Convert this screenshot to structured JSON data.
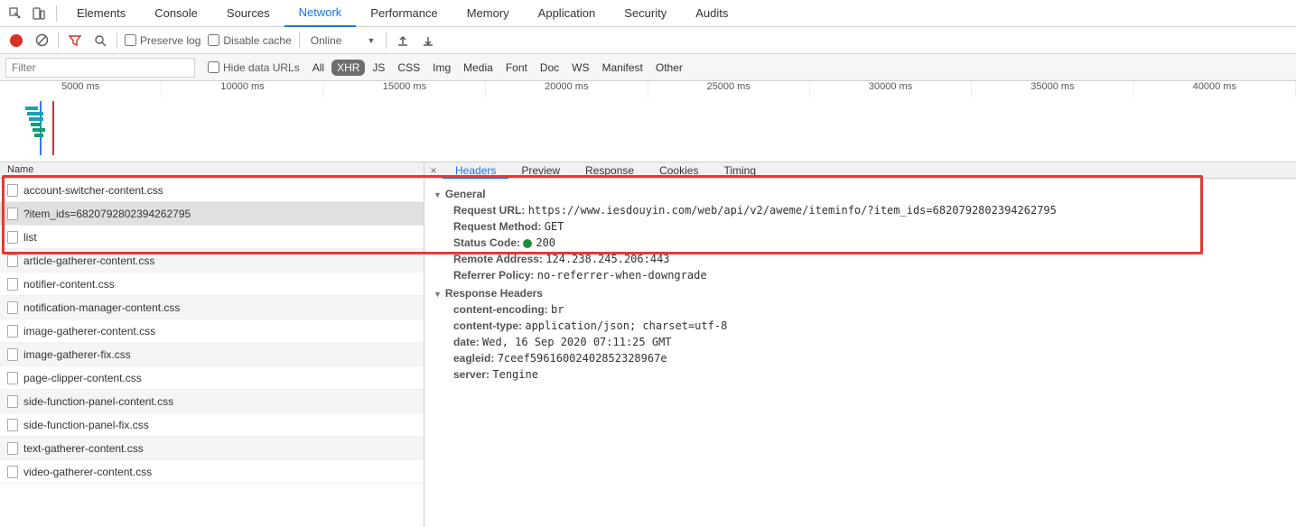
{
  "tabs": [
    "Elements",
    "Console",
    "Sources",
    "Network",
    "Performance",
    "Memory",
    "Application",
    "Security",
    "Audits"
  ],
  "active_tab": "Network",
  "toolbar": {
    "preserve_log": "Preserve log",
    "disable_cache": "Disable cache",
    "throttle": "Online"
  },
  "filter": {
    "placeholder": "Filter",
    "hide_data_urls": "Hide data URLs",
    "types": [
      "All",
      "XHR",
      "JS",
      "CSS",
      "Img",
      "Media",
      "Font",
      "Doc",
      "WS",
      "Manifest",
      "Other"
    ],
    "active_type": "XHR"
  },
  "timeline": {
    "ticks": [
      "5000 ms",
      "10000 ms",
      "15000 ms",
      "20000 ms",
      "25000 ms",
      "30000 ms",
      "35000 ms",
      "40000 ms"
    ]
  },
  "name_header": "Name",
  "detail_tabs": [
    "Headers",
    "Preview",
    "Response",
    "Cookies",
    "Timing"
  ],
  "active_detail_tab": "Headers",
  "requests": [
    "account-switcher-content.css",
    "?item_ids=6820792802394262795",
    "list",
    "article-gatherer-content.css",
    "notifier-content.css",
    "notification-manager-content.css",
    "image-gatherer-content.css",
    "image-gatherer-fix.css",
    "page-clipper-content.css",
    "side-function-panel-content.css",
    "side-function-panel-fix.css",
    "text-gatherer-content.css",
    "video-gatherer-content.css"
  ],
  "selected_request_index": 1,
  "headers": {
    "general_title": "General",
    "request_url_label": "Request URL:",
    "request_url": "https://www.iesdouyin.com/web/api/v2/aweme/iteminfo/?item_ids=6820792802394262795",
    "request_method_label": "Request Method:",
    "request_method": "GET",
    "status_code_label": "Status Code:",
    "status_code": "200",
    "remote_address_label": "Remote Address:",
    "remote_address": "124.238.245.206:443",
    "referrer_policy_label": "Referrer Policy:",
    "referrer_policy": "no-referrer-when-downgrade",
    "response_headers_title": "Response Headers",
    "resp": [
      {
        "k": "content-encoding:",
        "v": "br"
      },
      {
        "k": "content-type:",
        "v": "application/json; charset=utf-8"
      },
      {
        "k": "date:",
        "v": "Wed, 16 Sep 2020 07:11:25 GMT"
      },
      {
        "k": "eagleid:",
        "v": "7ceef59616002402852328967e"
      },
      {
        "k": "server:",
        "v": "Tengine"
      }
    ]
  }
}
